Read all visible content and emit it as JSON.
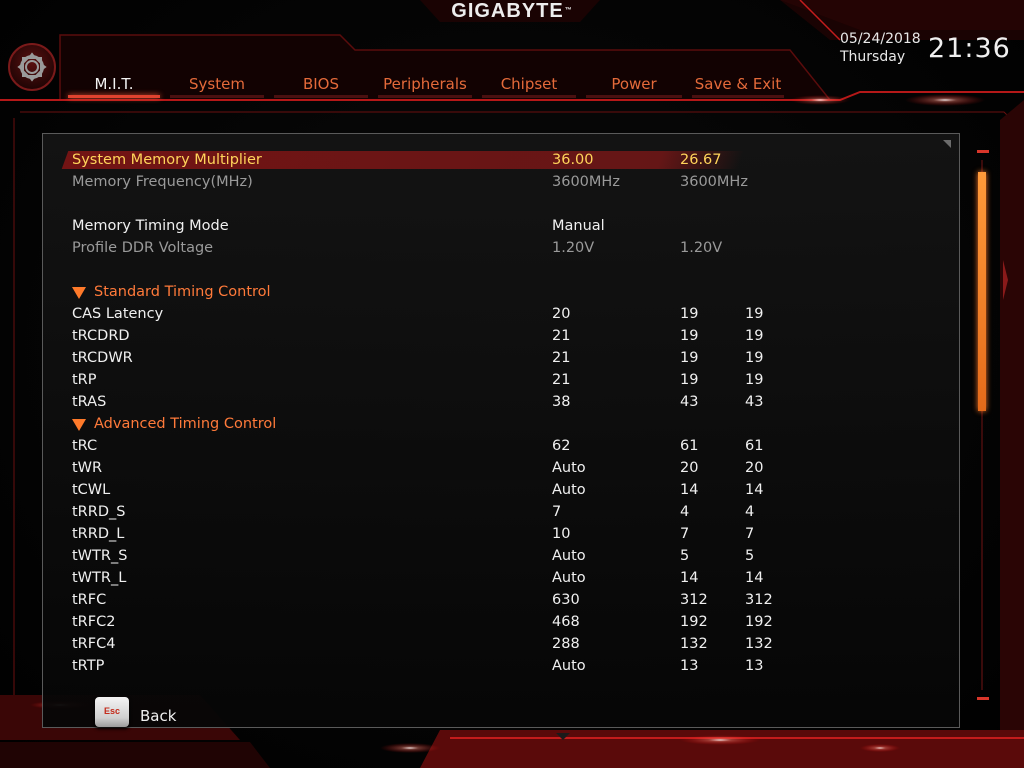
{
  "brand": "GIGABYTE",
  "brand_mark": "™",
  "tabs": [
    {
      "label": "M.I.T.",
      "active": true
    },
    {
      "label": "System",
      "active": false
    },
    {
      "label": "BIOS",
      "active": false
    },
    {
      "label": "Peripherals",
      "active": false
    },
    {
      "label": "Chipset",
      "active": false
    },
    {
      "label": "Power",
      "active": false
    },
    {
      "label": "Save & Exit",
      "active": false
    }
  ],
  "datetime": {
    "date": "05/24/2018",
    "day": "Thursday",
    "time": "21:36"
  },
  "settings": [
    {
      "type": "item",
      "state": "selected",
      "label": "System Memory Multiplier",
      "v1": "36.00",
      "v2": "26.67",
      "v3": ""
    },
    {
      "type": "item",
      "state": "dim",
      "label": "Memory Frequency(MHz)",
      "v1": "3600MHz",
      "v2": "3600MHz",
      "v3": ""
    },
    {
      "type": "blank"
    },
    {
      "type": "item",
      "state": "normal",
      "label": "Memory Timing Mode",
      "v1": "Manual",
      "v2": "",
      "v3": ""
    },
    {
      "type": "item",
      "state": "dim",
      "label": "Profile DDR Voltage",
      "v1": "1.20V",
      "v2": "1.20V",
      "v3": ""
    },
    {
      "type": "blank"
    },
    {
      "type": "section",
      "label": "Standard Timing Control"
    },
    {
      "type": "item",
      "state": "normal",
      "label": "CAS Latency",
      "v1": "20",
      "v2": "19",
      "v3": "19"
    },
    {
      "type": "item",
      "state": "normal",
      "label": "tRCDRD",
      "v1": "21",
      "v2": "19",
      "v3": "19"
    },
    {
      "type": "item",
      "state": "normal",
      "label": "tRCDWR",
      "v1": "21",
      "v2": "19",
      "v3": "19"
    },
    {
      "type": "item",
      "state": "normal",
      "label": "tRP",
      "v1": "21",
      "v2": "19",
      "v3": "19"
    },
    {
      "type": "item",
      "state": "normal",
      "label": "tRAS",
      "v1": "38",
      "v2": "43",
      "v3": "43"
    },
    {
      "type": "section",
      "label": "Advanced Timing Control"
    },
    {
      "type": "item",
      "state": "normal",
      "label": "tRC",
      "v1": "62",
      "v2": "61",
      "v3": "61"
    },
    {
      "type": "item",
      "state": "normal",
      "label": "tWR",
      "v1": "Auto",
      "v2": "20",
      "v3": "20"
    },
    {
      "type": "item",
      "state": "normal",
      "label": "tCWL",
      "v1": "Auto",
      "v2": "14",
      "v3": "14"
    },
    {
      "type": "item",
      "state": "normal",
      "label": "tRRD_S",
      "v1": "7",
      "v2": "4",
      "v3": "4"
    },
    {
      "type": "item",
      "state": "normal",
      "label": "tRRD_L",
      "v1": "10",
      "v2": "7",
      "v3": "7"
    },
    {
      "type": "item",
      "state": "normal",
      "label": "tWTR_S",
      "v1": "Auto",
      "v2": "5",
      "v3": "5"
    },
    {
      "type": "item",
      "state": "normal",
      "label": "tWTR_L",
      "v1": "Auto",
      "v2": "14",
      "v3": "14"
    },
    {
      "type": "item",
      "state": "normal",
      "label": "tRFC",
      "v1": "630",
      "v2": "312",
      "v3": "312"
    },
    {
      "type": "item",
      "state": "normal",
      "label": "tRFC2",
      "v1": "468",
      "v2": "192",
      "v3": "192"
    },
    {
      "type": "item",
      "state": "normal",
      "label": "tRFC4",
      "v1": "288",
      "v2": "132",
      "v3": "132"
    },
    {
      "type": "item",
      "state": "normal",
      "label": "tRTP",
      "v1": "Auto",
      "v2": "13",
      "v3": "13"
    }
  ],
  "scrollbar": {
    "position_fraction": 0.0,
    "visible_fraction": 0.46
  },
  "footer": {
    "esc_key": "Esc",
    "back_label": "Back"
  },
  "colors": {
    "accent_red": "#e0432f",
    "tab_text": "#e46a3a",
    "selected_text": "#ffd45a",
    "section_text": "#ff7a3a",
    "scroll_thumb": "#ff9a3a"
  },
  "icons": {
    "settings": "gear-icon",
    "section": "triangle-down-icon"
  }
}
